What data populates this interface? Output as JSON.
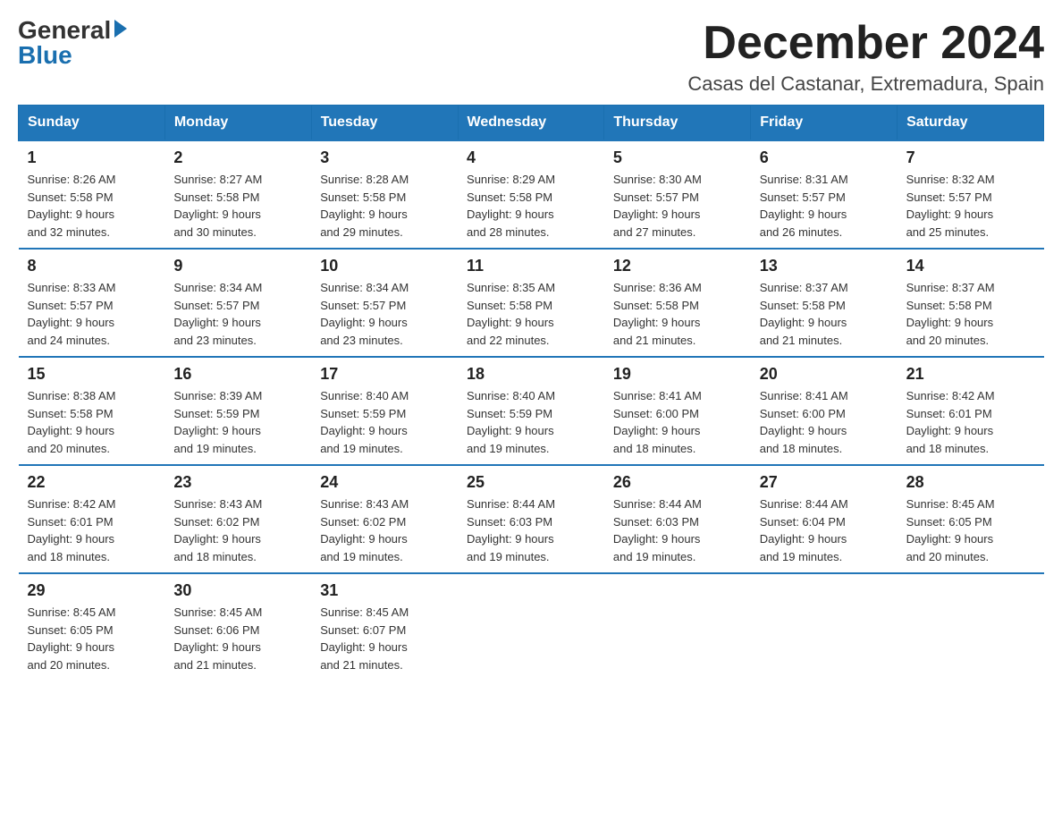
{
  "logo": {
    "general": "General",
    "blue": "Blue",
    "arrow": true
  },
  "title": "December 2024",
  "subtitle": "Casas del Castanar, Extremadura, Spain",
  "header": {
    "days": [
      "Sunday",
      "Monday",
      "Tuesday",
      "Wednesday",
      "Thursday",
      "Friday",
      "Saturday"
    ]
  },
  "weeks": [
    {
      "days": [
        {
          "num": "1",
          "sunrise": "8:26 AM",
          "sunset": "5:58 PM",
          "daylight": "9 hours and 32 minutes."
        },
        {
          "num": "2",
          "sunrise": "8:27 AM",
          "sunset": "5:58 PM",
          "daylight": "9 hours and 30 minutes."
        },
        {
          "num": "3",
          "sunrise": "8:28 AM",
          "sunset": "5:58 PM",
          "daylight": "9 hours and 29 minutes."
        },
        {
          "num": "4",
          "sunrise": "8:29 AM",
          "sunset": "5:58 PM",
          "daylight": "9 hours and 28 minutes."
        },
        {
          "num": "5",
          "sunrise": "8:30 AM",
          "sunset": "5:57 PM",
          "daylight": "9 hours and 27 minutes."
        },
        {
          "num": "6",
          "sunrise": "8:31 AM",
          "sunset": "5:57 PM",
          "daylight": "9 hours and 26 minutes."
        },
        {
          "num": "7",
          "sunrise": "8:32 AM",
          "sunset": "5:57 PM",
          "daylight": "9 hours and 25 minutes."
        }
      ]
    },
    {
      "days": [
        {
          "num": "8",
          "sunrise": "8:33 AM",
          "sunset": "5:57 PM",
          "daylight": "9 hours and 24 minutes."
        },
        {
          "num": "9",
          "sunrise": "8:34 AM",
          "sunset": "5:57 PM",
          "daylight": "9 hours and 23 minutes."
        },
        {
          "num": "10",
          "sunrise": "8:34 AM",
          "sunset": "5:57 PM",
          "daylight": "9 hours and 23 minutes."
        },
        {
          "num": "11",
          "sunrise": "8:35 AM",
          "sunset": "5:58 PM",
          "daylight": "9 hours and 22 minutes."
        },
        {
          "num": "12",
          "sunrise": "8:36 AM",
          "sunset": "5:58 PM",
          "daylight": "9 hours and 21 minutes."
        },
        {
          "num": "13",
          "sunrise": "8:37 AM",
          "sunset": "5:58 PM",
          "daylight": "9 hours and 21 minutes."
        },
        {
          "num": "14",
          "sunrise": "8:37 AM",
          "sunset": "5:58 PM",
          "daylight": "9 hours and 20 minutes."
        }
      ]
    },
    {
      "days": [
        {
          "num": "15",
          "sunrise": "8:38 AM",
          "sunset": "5:58 PM",
          "daylight": "9 hours and 20 minutes."
        },
        {
          "num": "16",
          "sunrise": "8:39 AM",
          "sunset": "5:59 PM",
          "daylight": "9 hours and 19 minutes."
        },
        {
          "num": "17",
          "sunrise": "8:40 AM",
          "sunset": "5:59 PM",
          "daylight": "9 hours and 19 minutes."
        },
        {
          "num": "18",
          "sunrise": "8:40 AM",
          "sunset": "5:59 PM",
          "daylight": "9 hours and 19 minutes."
        },
        {
          "num": "19",
          "sunrise": "8:41 AM",
          "sunset": "6:00 PM",
          "daylight": "9 hours and 18 minutes."
        },
        {
          "num": "20",
          "sunrise": "8:41 AM",
          "sunset": "6:00 PM",
          "daylight": "9 hours and 18 minutes."
        },
        {
          "num": "21",
          "sunrise": "8:42 AM",
          "sunset": "6:01 PM",
          "daylight": "9 hours and 18 minutes."
        }
      ]
    },
    {
      "days": [
        {
          "num": "22",
          "sunrise": "8:42 AM",
          "sunset": "6:01 PM",
          "daylight": "9 hours and 18 minutes."
        },
        {
          "num": "23",
          "sunrise": "8:43 AM",
          "sunset": "6:02 PM",
          "daylight": "9 hours and 18 minutes."
        },
        {
          "num": "24",
          "sunrise": "8:43 AM",
          "sunset": "6:02 PM",
          "daylight": "9 hours and 19 minutes."
        },
        {
          "num": "25",
          "sunrise": "8:44 AM",
          "sunset": "6:03 PM",
          "daylight": "9 hours and 19 minutes."
        },
        {
          "num": "26",
          "sunrise": "8:44 AM",
          "sunset": "6:03 PM",
          "daylight": "9 hours and 19 minutes."
        },
        {
          "num": "27",
          "sunrise": "8:44 AM",
          "sunset": "6:04 PM",
          "daylight": "9 hours and 19 minutes."
        },
        {
          "num": "28",
          "sunrise": "8:45 AM",
          "sunset": "6:05 PM",
          "daylight": "9 hours and 20 minutes."
        }
      ]
    },
    {
      "days": [
        {
          "num": "29",
          "sunrise": "8:45 AM",
          "sunset": "6:05 PM",
          "daylight": "9 hours and 20 minutes."
        },
        {
          "num": "30",
          "sunrise": "8:45 AM",
          "sunset": "6:06 PM",
          "daylight": "9 hours and 21 minutes."
        },
        {
          "num": "31",
          "sunrise": "8:45 AM",
          "sunset": "6:07 PM",
          "daylight": "9 hours and 21 minutes."
        },
        null,
        null,
        null,
        null
      ]
    }
  ]
}
